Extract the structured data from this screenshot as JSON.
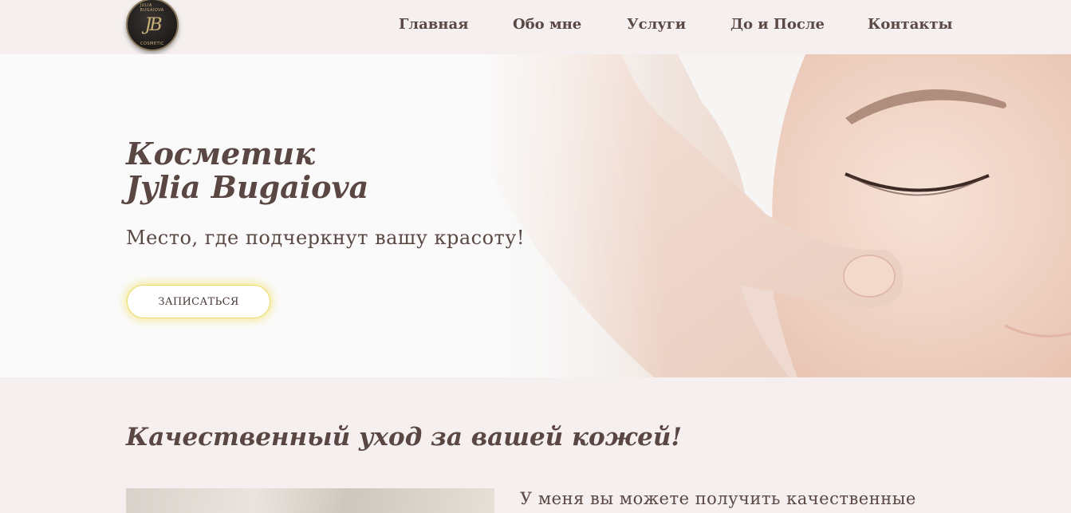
{
  "header": {
    "logo": {
      "monogram": "JB",
      "ring_top": "JULIA BUGAIOVA",
      "ring_bottom": "COSMETIC"
    },
    "nav": [
      {
        "label": "Главная"
      },
      {
        "label": "Обо мне"
      },
      {
        "label": "Услуги"
      },
      {
        "label": "До и После"
      },
      {
        "label": "Контакты"
      }
    ]
  },
  "hero": {
    "title_line1": "Косметик",
    "title_line2": "Jylia Bugaiova",
    "subtitle": "Место, где подчеркнут вашу красоту!",
    "cta_label": "ЗАПИСАТЬСЯ"
  },
  "section": {
    "title": "Качественный уход за вашей кожей!",
    "text": "У меня вы можете получить качественные"
  },
  "colors": {
    "background": "#f5f0ef",
    "text": "#5a4642",
    "cta_glow": "#eadc6a"
  }
}
